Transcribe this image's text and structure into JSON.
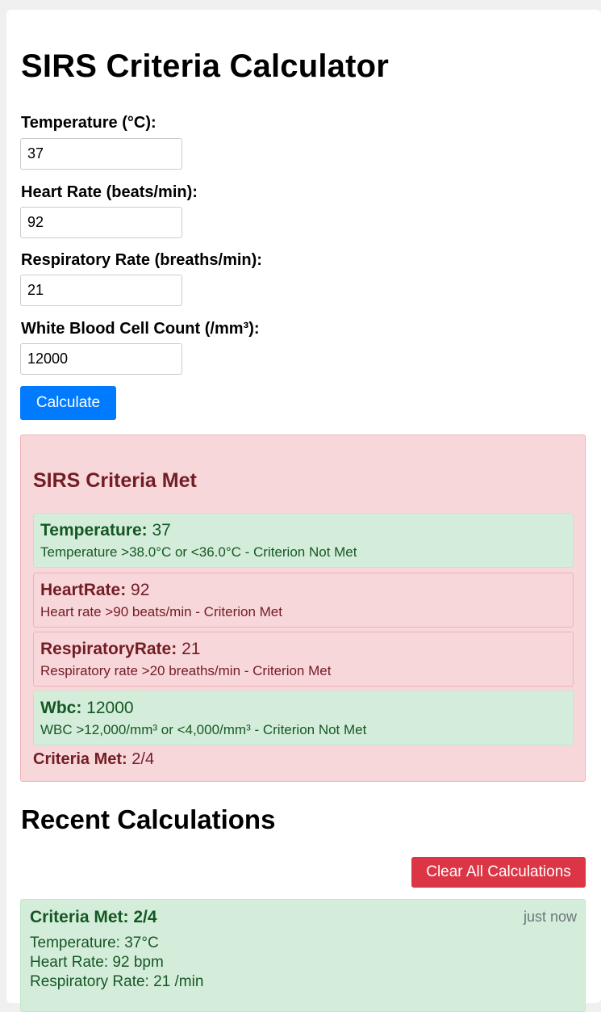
{
  "page": {
    "title": "SIRS Criteria Calculator"
  },
  "form": {
    "temperature": {
      "label": "Temperature (°C):",
      "value": "37"
    },
    "heart_rate": {
      "label": "Heart Rate (beats/min):",
      "value": "92"
    },
    "respiratory_rate": {
      "label": "Respiratory Rate (breaths/min):",
      "value": "21"
    },
    "wbc": {
      "label": "White Blood Cell Count (/mm³):",
      "value": "12000"
    },
    "calculate_label": "Calculate"
  },
  "result": {
    "title": "SIRS Criteria Met",
    "criteria": [
      {
        "name": "Temperature:",
        "value": "37",
        "description": "Temperature >38.0°C or <36.0°C - Criterion Not Met",
        "met": false
      },
      {
        "name": "HeartRate:",
        "value": "92",
        "description": "Heart rate >90 beats/min - Criterion Met",
        "met": true
      },
      {
        "name": "RespiratoryRate:",
        "value": "21",
        "description": "Respiratory rate >20 breaths/min - Criterion Met",
        "met": true
      },
      {
        "name": "Wbc:",
        "value": "12000",
        "description": "WBC >12,000/mm³ or <4,000/mm³ - Criterion Not Met",
        "met": false
      }
    ],
    "summary_label": "Criteria Met:",
    "summary_value": "2/4"
  },
  "recent": {
    "heading": "Recent Calculations",
    "clear_label": "Clear All Calculations",
    "items": [
      {
        "title": "Criteria Met: 2/4",
        "time": "just now",
        "lines": [
          "Temperature: 37°C",
          "Heart Rate: 92 bpm",
          "Respiratory Rate: 21 /min"
        ]
      }
    ]
  },
  "colors": {
    "primary": "#007bff",
    "danger": "#dc3545",
    "met_bg": "#f8d7da",
    "met_text": "#721c24",
    "notmet_bg": "#d4edda",
    "notmet_text": "#155724"
  }
}
